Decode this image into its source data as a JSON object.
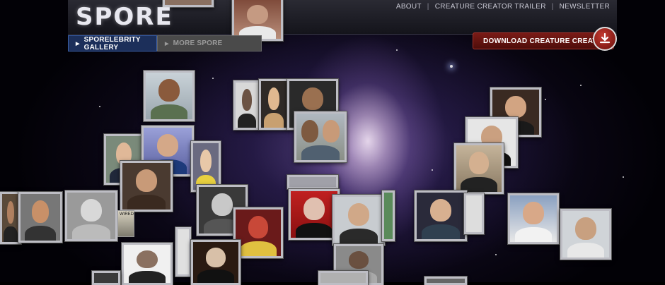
{
  "brand": {
    "logo_text": "SPORE"
  },
  "top_nav": {
    "items": [
      {
        "label": "ABOUT"
      },
      {
        "label": "CREATURE CREATOR TRAILER"
      },
      {
        "label": "NEWSLETTER"
      }
    ],
    "separator": "|"
  },
  "tabs": [
    {
      "label": "SPORELEBRITY GALLERY",
      "active": true
    },
    {
      "label": "MORE SPORE",
      "active": false
    }
  ],
  "download": {
    "label": "DOWNLOAD CREATURE CREATOR",
    "icon": "download-arrow-icon"
  },
  "sticker_text": "WIRED",
  "colors": {
    "active_tab": "#1c2f5a",
    "download_button": "#7a1b16",
    "frame": "#bdbdc4"
  }
}
